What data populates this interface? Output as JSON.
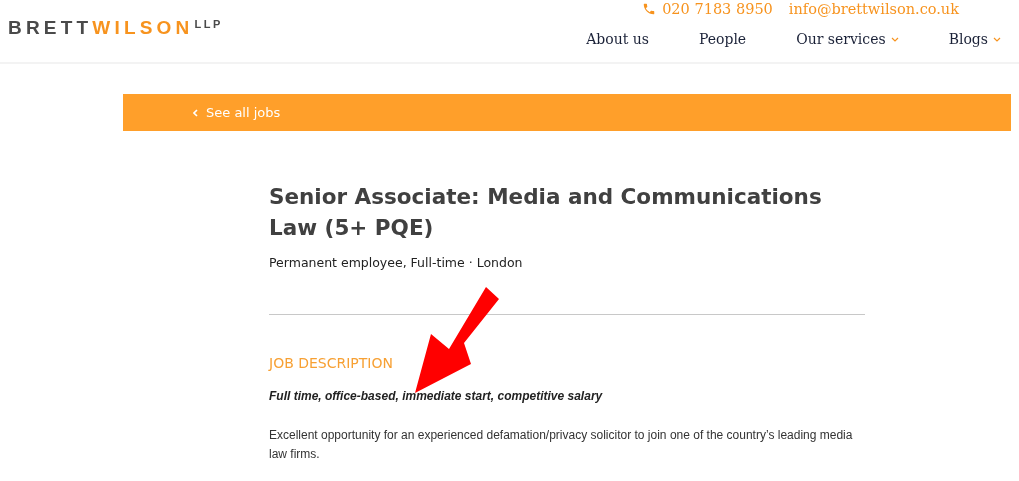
{
  "logo": {
    "first": "BRETT",
    "second": "WILSON",
    "suffix": "LLP"
  },
  "contact": {
    "phone": "020 7183 8950",
    "email": "info@brettwilson.co.uk"
  },
  "nav": [
    {
      "label": "About us",
      "has_dropdown": false
    },
    {
      "label": "People",
      "has_dropdown": false
    },
    {
      "label": "Our services",
      "has_dropdown": true
    },
    {
      "label": "Blogs",
      "has_dropdown": true
    }
  ],
  "back_link": "See all jobs",
  "job": {
    "title": "Senior Associate: Media and Communications Law (5+ PQE)",
    "meta": "Permanent employee, Full-time · London",
    "section_heading": "JOB DESCRIPTION",
    "summary": "Full time, office-based, immediate start, competitive salary",
    "body": "Excellent opportunity for an experienced defamation/privacy solicitor to join one of the country’s leading media law firms."
  }
}
